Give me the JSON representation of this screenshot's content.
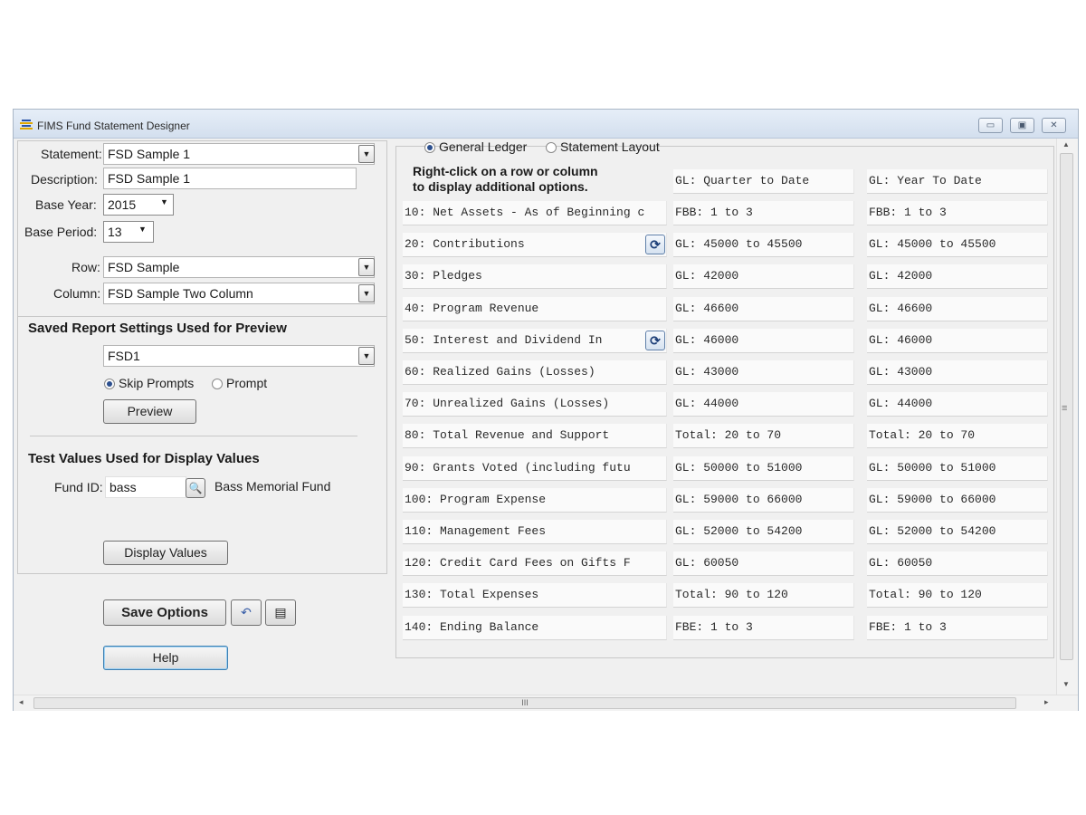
{
  "window": {
    "title": "FIMS Fund Statement Designer"
  },
  "form": {
    "statement_label": "Statement:",
    "statement_value": "FSD Sample 1",
    "description_label": "Description:",
    "description_value": "FSD Sample 1",
    "base_year_label": "Base Year:",
    "base_year_value": "2015",
    "base_period_label": "Base Period:",
    "base_period_value": "13",
    "row_label": "Row:",
    "row_value": "FSD Sample",
    "column_label": "Column:",
    "column_value": "FSD Sample Two Column"
  },
  "saved_report": {
    "title": "Saved Report Settings Used for Preview",
    "value": "FSD1",
    "skip_prompts": "Skip Prompts",
    "prompt": "Prompt",
    "selected": "skip_prompts",
    "preview_button": "Preview"
  },
  "test_values": {
    "title": "Test Values Used for Display Values",
    "fund_id_label": "Fund ID:",
    "fund_id_value": "bass",
    "fund_name": "Bass Memorial Fund",
    "display_button": "Display Values"
  },
  "actions": {
    "save_options": "Save Options",
    "help": "Help"
  },
  "grid": {
    "mode_general_ledger": "General Ledger",
    "mode_statement_layout": "Statement Layout",
    "selected_mode": "general_ledger",
    "instructions_line1": "Right-click on a row or column",
    "instructions_line2": "to display additional options.",
    "col1_header": "GL: Quarter to Date",
    "col2_header": "GL: Year To Date",
    "rows": [
      {
        "label": "10: Net Assets - As of Beginning c",
        "c1": "FBB: 1 to 3",
        "c2": "FBB: 1 to 3",
        "refresh": false
      },
      {
        "label": "20:   Contributions",
        "c1": "GL: 45000 to 45500",
        "c2": "GL: 45000 to 45500",
        "refresh": true
      },
      {
        "label": "30:   Pledges",
        "c1": "GL: 42000",
        "c2": "GL: 42000",
        "refresh": false
      },
      {
        "label": "40:   Program Revenue",
        "c1": "GL: 46600",
        "c2": "GL: 46600",
        "refresh": false
      },
      {
        "label": "50:   Interest and Dividend In",
        "c1": "GL: 46000",
        "c2": "GL: 46000",
        "refresh": true
      },
      {
        "label": "60:   Realized Gains (Losses)",
        "c1": "GL: 43000",
        "c2": "GL: 43000",
        "refresh": false
      },
      {
        "label": "70:   Unrealized Gains (Losses)",
        "c1": "GL: 44000",
        "c2": "GL: 44000",
        "refresh": false
      },
      {
        "label": "80: Total Revenue and Support",
        "c1": "Total: 20 to 70",
        "c2": "Total: 20 to 70",
        "refresh": false
      },
      {
        "label": "90:   Grants Voted (including futu",
        "c1": "GL: 50000 to 51000",
        "c2": "GL: 50000 to 51000",
        "refresh": false
      },
      {
        "label": "100:   Program Expense",
        "c1": "GL: 59000 to 66000",
        "c2": "GL: 59000 to 66000",
        "refresh": false
      },
      {
        "label": "110:   Management Fees",
        "c1": "GL: 52000 to 54200",
        "c2": "GL: 52000 to 54200",
        "refresh": false
      },
      {
        "label": "120:   Credit Card Fees on Gifts F",
        "c1": "GL: 60050",
        "c2": "GL: 60050",
        "refresh": false
      },
      {
        "label": "130: Total Expenses",
        "c1": "Total: 90 to 120",
        "c2": "Total: 90 to 120",
        "refresh": false
      },
      {
        "label": "140: Ending Balance",
        "c1": "FBE: 1 to 3",
        "c2": "FBE: 1 to 3",
        "refresh": false
      }
    ]
  },
  "scrollbar": {
    "hscroll_grip": "III",
    "vscroll_grip": "≡"
  }
}
